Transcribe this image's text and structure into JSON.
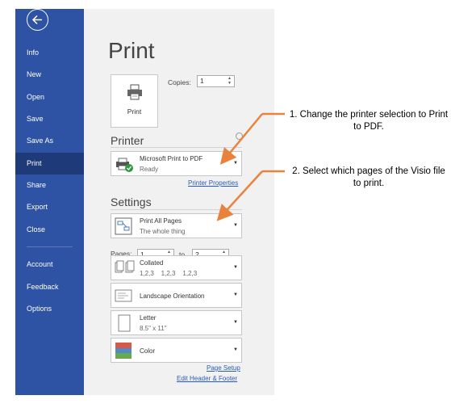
{
  "sidebar": {
    "back_icon": "back-arrow-icon",
    "items": [
      {
        "label": "Info"
      },
      {
        "label": "New"
      },
      {
        "label": "Open"
      },
      {
        "label": "Save"
      },
      {
        "label": "Save As"
      },
      {
        "label": "Print",
        "active": true
      },
      {
        "label": "Share"
      },
      {
        "label": "Export"
      },
      {
        "label": "Close"
      },
      {
        "label": "Account"
      },
      {
        "label": "Feedback"
      },
      {
        "label": "Options"
      }
    ]
  },
  "main": {
    "title": "Print",
    "print_button_label": "Print",
    "copies_label": "Copies:",
    "copies_value": "1",
    "printer_heading": "Printer",
    "printer": {
      "name": "Microsoft Print to PDF",
      "status": "Ready"
    },
    "printer_properties": "Printer Properties",
    "settings_heading": "Settings",
    "pages_setting": {
      "line1": "Print All Pages",
      "line2": "The whole thing"
    },
    "pages_label": "Pages:",
    "pages_from": "1",
    "pages_to_label": "to",
    "pages_to": "2",
    "collation": {
      "line1": "Collated",
      "line2": "1,2,3    1,2,3    1,2,3"
    },
    "orientation": {
      "line1": "Landscape Orientation"
    },
    "paper": {
      "line1": "Letter",
      "line2": "8.5\" x 11\""
    },
    "color": {
      "line1": "Color"
    },
    "page_setup": "Page Setup",
    "edit_header_footer": "Edit Header & Footer"
  },
  "annotations": [
    {
      "text": "1. Change the printer selection to Print to PDF."
    },
    {
      "text": "2. Select which pages of the Visio file to print."
    }
  ],
  "colors": {
    "sidebar": "#2e52a4",
    "sidebar_active": "#1f3a78",
    "arrow": "#e8823c",
    "link": "#2a5bb8"
  }
}
